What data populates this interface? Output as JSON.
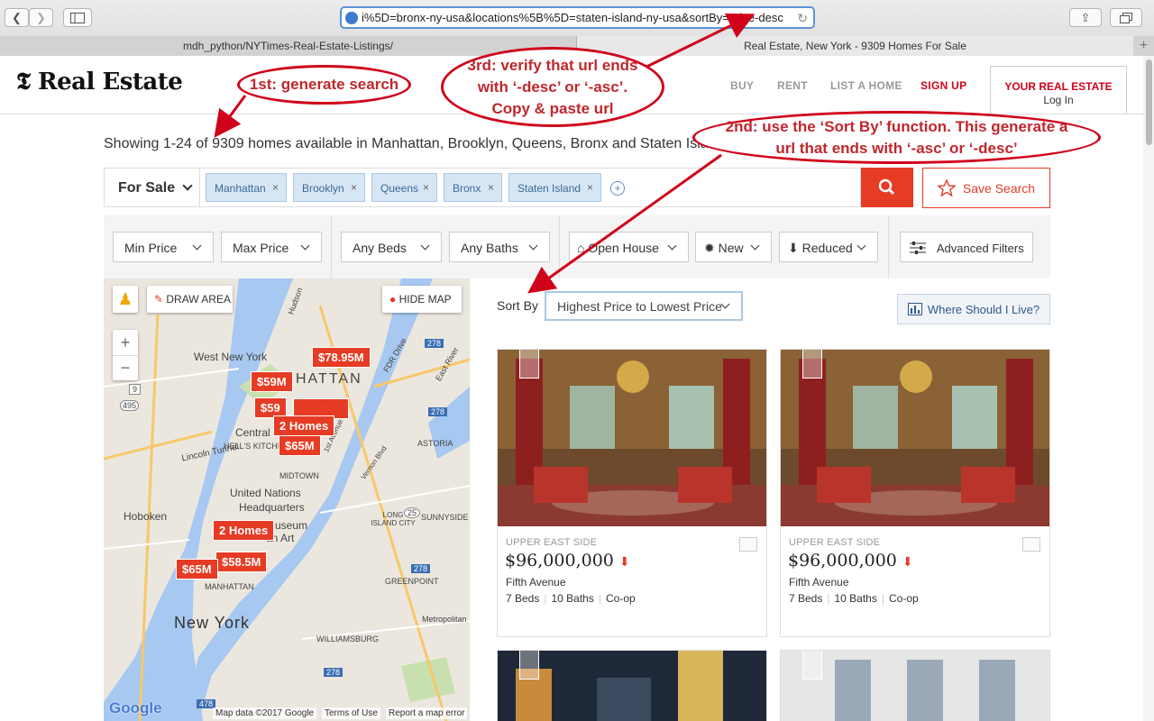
{
  "browser": {
    "url_fragment": "i%5D=bronx-ny-usa&locations%5B%5D=staten-island-ny-usa&sortBy=price-desc",
    "tabs": [
      {
        "title": "mdh_python/NYTimes-Real-Estate-Listings/"
      },
      {
        "title": "Real Estate, New York - 9309 Homes For Sale"
      }
    ],
    "new_tab": "+"
  },
  "header": {
    "logo": "Real Estate",
    "nav": [
      "BUY",
      "RENT",
      "LIST A HOME",
      "SIGN UP"
    ],
    "my_real_estate": "YOUR REAL ESTATE",
    "login": "Log In"
  },
  "results_summary": "Showing 1-24 of 9309 homes available in Manhattan, Brooklyn, Queens, Bronx and Staten Island",
  "search": {
    "listing_type": "For Sale",
    "locations": [
      "Manhattan",
      "Brooklyn",
      "Queens",
      "Bronx",
      "Staten Island"
    ],
    "remove_glyph": "×",
    "add_glyph": "+",
    "save_label": "Save Search"
  },
  "filters": {
    "min_price": "Min Price",
    "max_price": "Max Price",
    "beds": "Any Beds",
    "baths": "Any Baths",
    "open_house": "Open House",
    "new": "New",
    "reduced": "Reduced",
    "advanced": "Advanced Filters"
  },
  "map": {
    "draw_area": "DRAW AREA",
    "hide_map": "HIDE MAP",
    "zoom_in": "+",
    "zoom_out": "−",
    "pins": [
      "$78.95M",
      "$59M",
      "$59",
      "2 Homes",
      "$65M",
      "2 Homes",
      "$58.5M",
      "$65M"
    ],
    "labels": [
      "West New York",
      "HATTAN",
      "Central Park",
      "HELL'S KITCHEN",
      "MIDTOWN",
      "United Nations",
      "Headquarters",
      "Hoboken",
      "Museum",
      "an Art",
      "ASTORIA",
      "SUNNYSIDE",
      "GREENPOINT",
      "LONG ISLAND CITY",
      "MANHATTAN",
      "WILLIAMSBURG",
      "Metropolitan",
      "New York",
      "Lincoln Tunnel",
      "Hudson",
      "FDR Drive",
      "East River",
      "1st Avenue",
      "Vernon Blvd",
      "495",
      "9",
      "278",
      "25",
      "478"
    ],
    "footer": {
      "brand": "Google",
      "data": "Map data ©2017 Google",
      "terms": "Terms of Use",
      "report": "Report a map error"
    }
  },
  "sort": {
    "label": "Sort By",
    "value": "Highest Price to Lowest Price"
  },
  "where_should_i_live": "Where Should I Live?",
  "listings": [
    {
      "neighborhood": "UPPER EAST SIDE",
      "price": "$96,000,000",
      "street": "Fifth Avenue",
      "beds": "7 Beds",
      "baths": "10 Baths",
      "type": "Co-op"
    },
    {
      "neighborhood": "UPPER EAST SIDE",
      "price": "$96,000,000",
      "street": "Fifth Avenue",
      "beds": "7 Beds",
      "baths": "10 Baths",
      "type": "Co-op"
    }
  ],
  "annotations": {
    "first": "1st: generate search",
    "second_a": "2nd: use the ‘Sort By’ function. This generate a",
    "second_b": "url that ends with ‘-asc’ or ‘-desc’",
    "third_a": "3rd: verify that url ends",
    "third_b": "with ‘-desc’ or ‘-asc’.",
    "third_c": "Copy & paste url"
  },
  "colors": {
    "accent": "#e63b24",
    "annotation": "#d0021b",
    "chip": "#d6e6f5"
  }
}
